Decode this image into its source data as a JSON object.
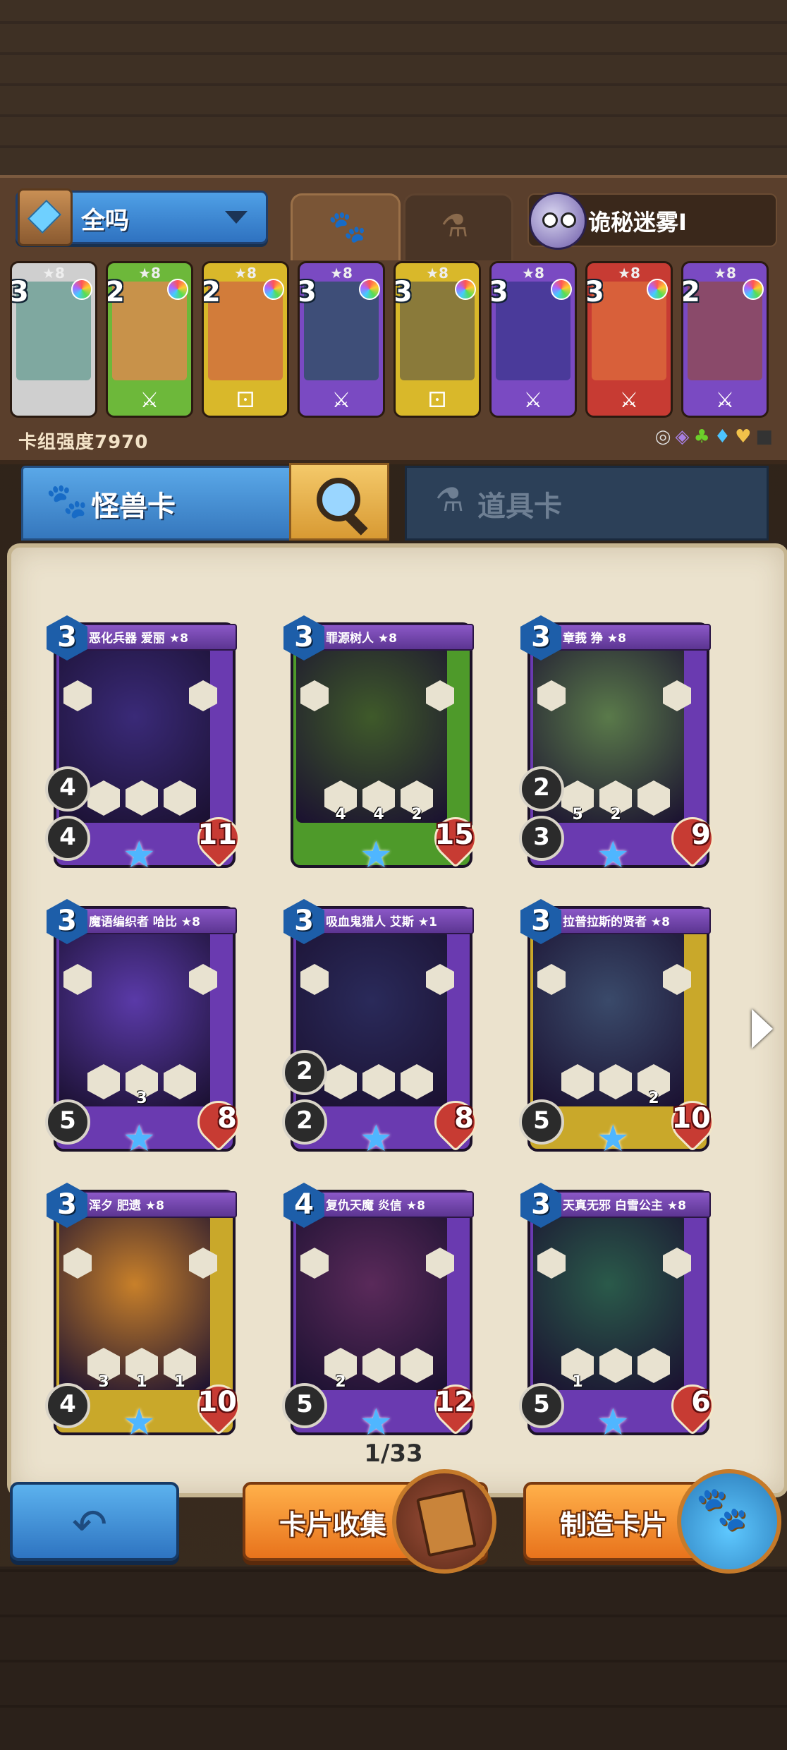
{
  "header": {
    "deck_name": "全吗",
    "opponent_name": "诡秘迷雾I",
    "tabs": [
      {
        "label": "",
        "icon": "paw-icon",
        "active": true
      },
      {
        "label": "",
        "icon": "flask-icon",
        "active": false
      }
    ]
  },
  "deck": {
    "cards": [
      {
        "cost": "3",
        "stars": "★8",
        "frame_color": "#cfcfcf",
        "art_color": "#7fa8a0",
        "bottom_icon": ""
      },
      {
        "cost": "2",
        "stars": "★8",
        "frame_color": "#6db83a",
        "art_color": "#c8924a",
        "bottom_icon": "⚔"
      },
      {
        "cost": "2",
        "stars": "★8",
        "frame_color": "#d9b82a",
        "art_color": "#d27c3a",
        "bottom_icon": "⚀"
      },
      {
        "cost": "3",
        "stars": "★8",
        "frame_color": "#7a4ac2",
        "art_color": "#3e4e78",
        "bottom_icon": "⚔"
      },
      {
        "cost": "3",
        "stars": "★8",
        "frame_color": "#d9b82a",
        "art_color": "#8a7a3a",
        "bottom_icon": "⚀"
      },
      {
        "cost": "3",
        "stars": "★8",
        "frame_color": "#7a4ac2",
        "art_color": "#4a3a9a",
        "bottom_icon": "⚔"
      },
      {
        "cost": "3",
        "stars": "★8",
        "frame_color": "#c73b33",
        "art_color": "#d8603a",
        "bottom_icon": "⚔"
      },
      {
        "cost": "2",
        "stars": "★8",
        "frame_color": "#7a4ac2",
        "art_color": "#8a4a6a",
        "bottom_icon": "⚔"
      }
    ],
    "power_label": "卡组强度7970",
    "element_icons": [
      "◎",
      "◈",
      "♣",
      "♦",
      "♥",
      "■"
    ]
  },
  "categories": {
    "monster_label": "怪兽卡",
    "item_label": "道具卡"
  },
  "cards": [
    {
      "cost": "3",
      "name": "恶化兵器 爱丽 ★8",
      "frame": "#6a3ab0",
      "art": "#3a2a78",
      "cost_bg": "#1d5ea9",
      "attack": "4",
      "defense": "4",
      "health": "11",
      "ab1": "",
      "ab2": "",
      "ab3": ""
    },
    {
      "cost": "3",
      "name": "罪源树人 ★8",
      "frame": "#4e9a2a",
      "art": "#3f5a2a",
      "cost_bg": "#1d5ea9",
      "attack": "",
      "defense": "",
      "health": "15",
      "ab1": "4",
      "ab2": "4",
      "ab3": "2"
    },
    {
      "cost": "3",
      "name": "章莪 狰 ★8",
      "frame": "#6a3ab0",
      "art": "#5a7a4a",
      "cost_bg": "#1d5ea9",
      "attack": "2",
      "defense": "3",
      "health": "9",
      "ab1": "5",
      "ab2": "2",
      "ab3": ""
    },
    {
      "cost": "3",
      "name": "魔语编织者 哈比 ★8",
      "frame": "#6a3ab0",
      "art": "#5a3aa8",
      "cost_bg": "#1d5ea9",
      "attack": "",
      "defense": "5",
      "health": "8",
      "ab1": "",
      "ab2": "3",
      "ab3": ""
    },
    {
      "cost": "3",
      "name": "吸血鬼猎人 艾斯 ★1",
      "frame": "#6a3ab0",
      "art": "#2a2a5a",
      "cost_bg": "#1d5ea9",
      "attack": "2",
      "defense": "2",
      "health": "8",
      "ab1": "",
      "ab2": "",
      "ab3": ""
    },
    {
      "cost": "3",
      "name": "拉普拉斯的贤者 ★8",
      "frame": "#c9a82a",
      "art": "#3a4a6a",
      "cost_bg": "#1d5ea9",
      "attack": "",
      "defense": "5",
      "health": "10",
      "ab1": "",
      "ab2": "",
      "ab3": "2"
    },
    {
      "cost": "3",
      "name": "浑夕 肥遗 ★8",
      "frame": "#c9a82a",
      "art": "#c8802a",
      "cost_bg": "#1d5ea9",
      "attack": "",
      "defense": "4",
      "health": "10",
      "ab1": "3",
      "ab2": "1",
      "ab3": "1"
    },
    {
      "cost": "4",
      "name": "复仇天魔 炎信 ★8",
      "frame": "#6a3ab0",
      "art": "#5a2a5a",
      "cost_bg": "#1d5ea9",
      "attack": "",
      "defense": "5",
      "health": "12",
      "ab1": "2",
      "ab2": "",
      "ab3": ""
    },
    {
      "cost": "3",
      "name": "天真无邪 白雪公主 ★8",
      "frame": "#6a3ab0",
      "art": "#2a5a4a",
      "cost_bg": "#1d5ea9",
      "attack": "",
      "defense": "5",
      "health": "6",
      "ab1": "1",
      "ab2": "",
      "ab3": ""
    }
  ],
  "pager": {
    "text": "1/33"
  },
  "buttons": {
    "back_label": "",
    "collect_label": "卡片收集",
    "craft_label": "制造卡片"
  }
}
